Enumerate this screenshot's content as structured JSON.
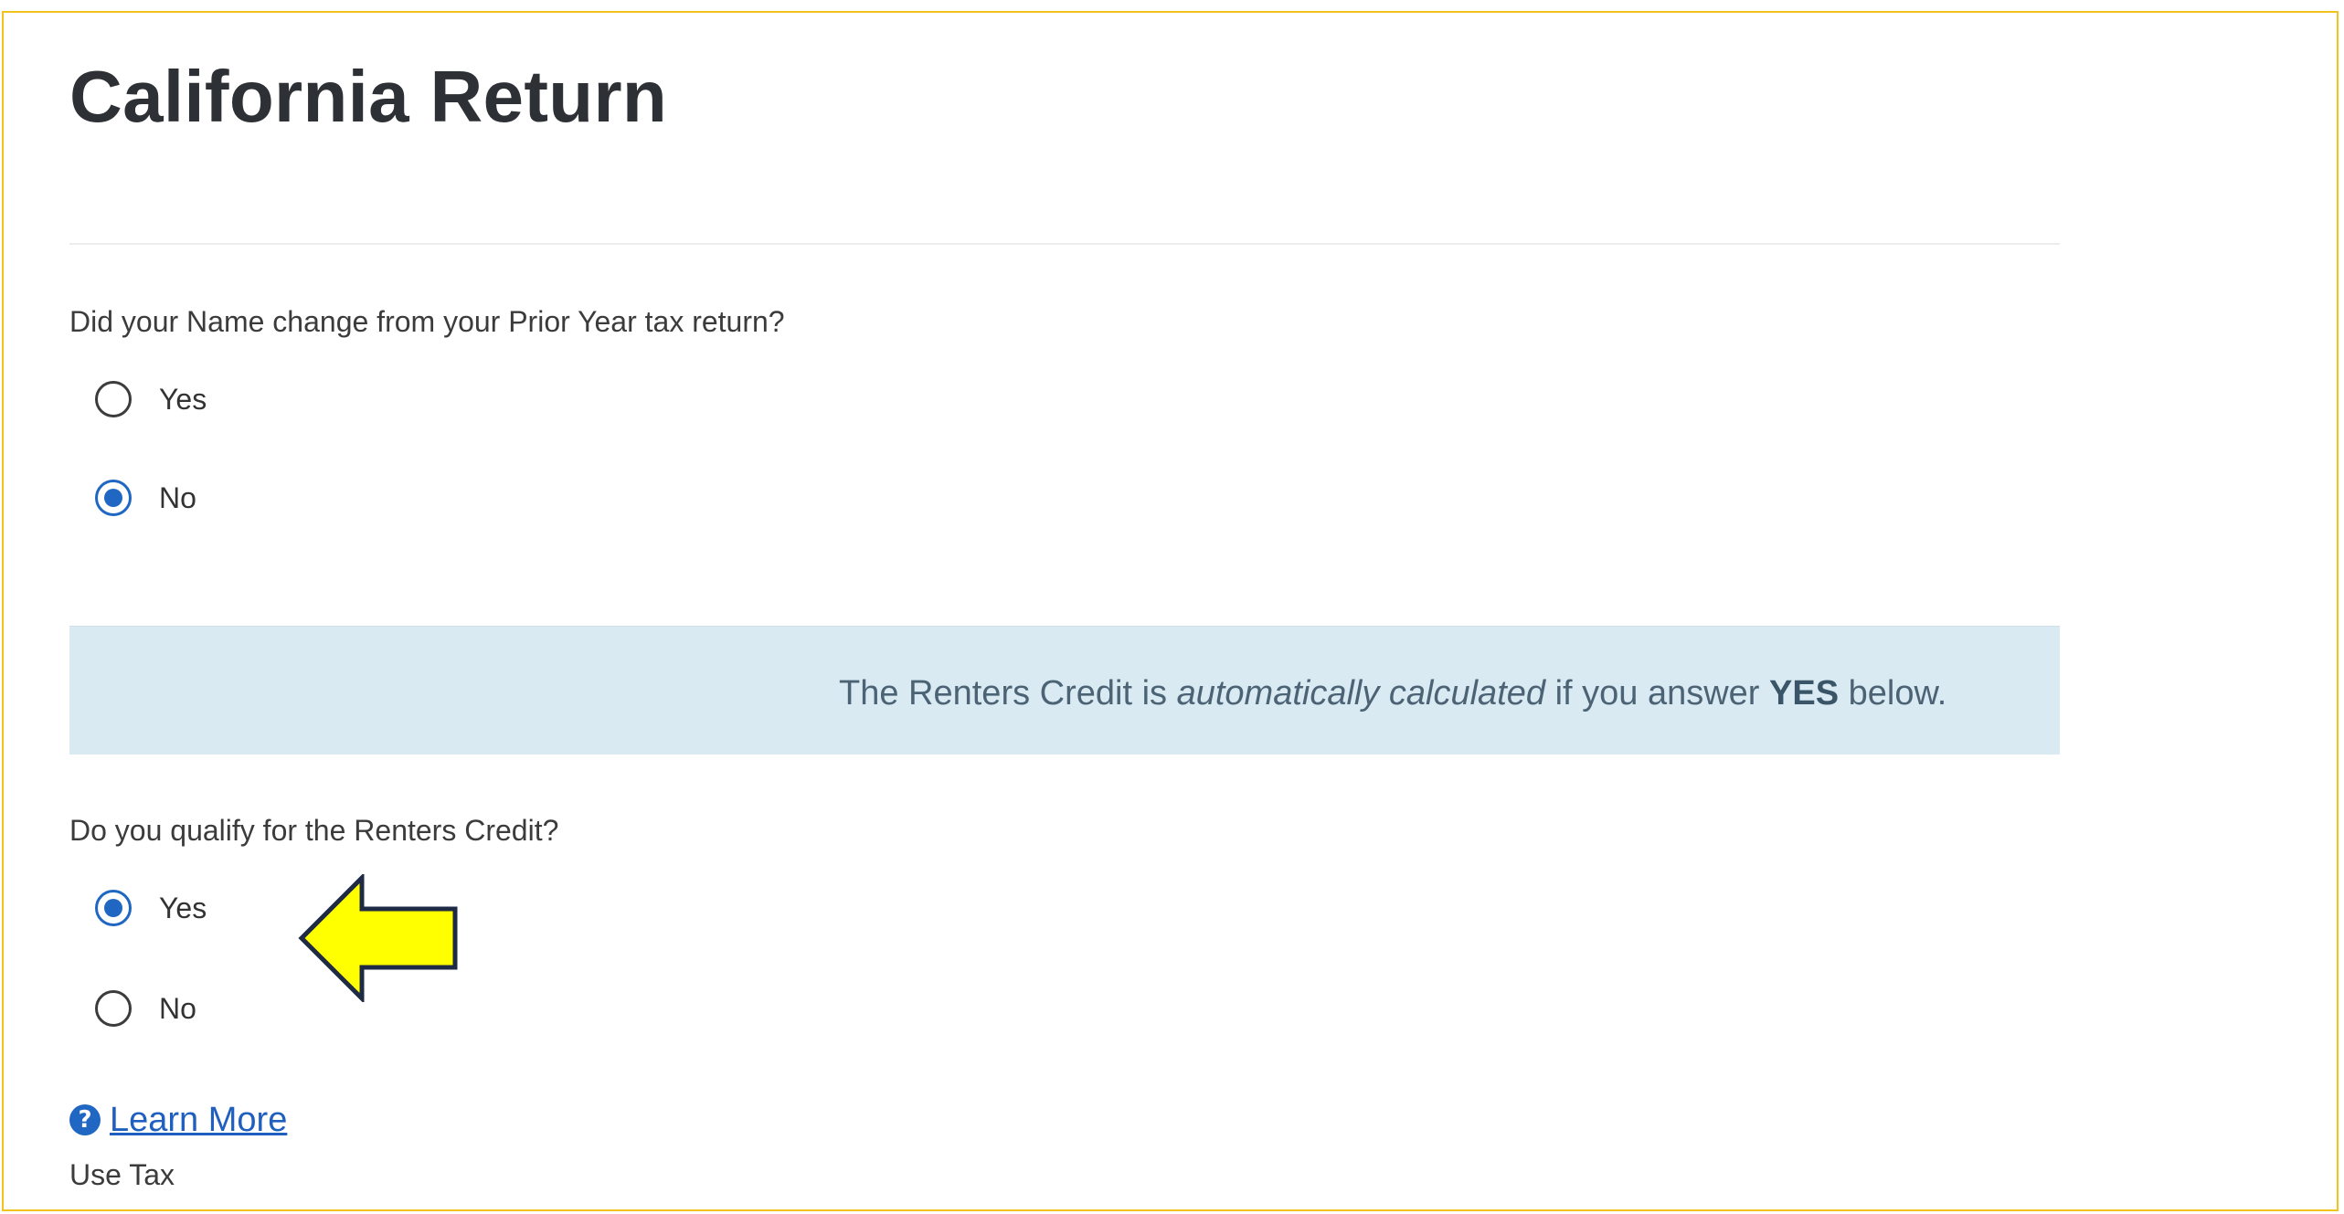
{
  "page": {
    "title": "California Return"
  },
  "name_change": {
    "question": "Did your Name change from your Prior Year tax return?",
    "options": [
      {
        "label": "Yes",
        "selected": false
      },
      {
        "label": "No",
        "selected": true
      }
    ]
  },
  "info_banner": {
    "text_before": "The Renters Credit is ",
    "text_italic": "automatically calculated",
    "text_middle": " if you answer ",
    "text_bold": "YES",
    "text_after": " below."
  },
  "renters_credit": {
    "question": "Do you qualify for the Renters Credit?",
    "options": [
      {
        "label": "Yes",
        "selected": true
      },
      {
        "label": "No",
        "selected": false
      }
    ]
  },
  "learn_more": {
    "icon": "help-circle-icon",
    "label": "Learn More"
  },
  "next_section": {
    "label": "Use Tax"
  },
  "annotation": {
    "icon": "arrow-left-icon"
  },
  "colors": {
    "frame_border": "#f2c31c",
    "radio_selected": "#1f67c2",
    "banner_background": "#d9eaf3",
    "banner_text": "#4b6374",
    "link": "#1f5fbf",
    "annotation_arrow_fill": "#ffff00",
    "annotation_arrow_stroke": "#1f2a44"
  }
}
